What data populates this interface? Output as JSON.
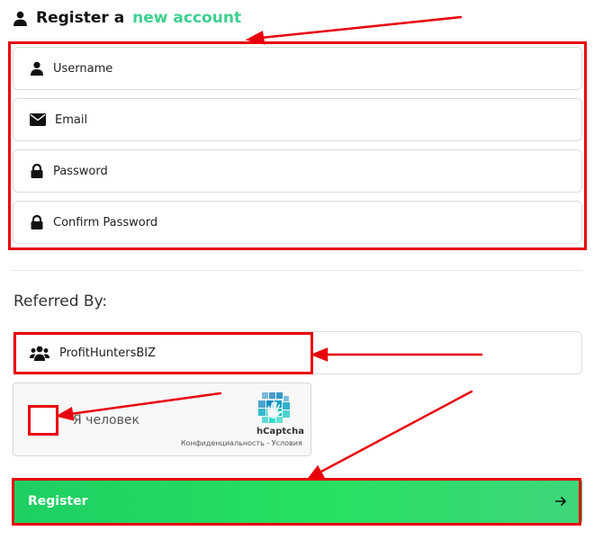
{
  "header": {
    "title_prefix": "Register a",
    "title_accent": "new account",
    "accent_color": "#3ecf8e",
    "icon": "user-icon"
  },
  "form": {
    "username_placeholder": "Username",
    "email_placeholder": "Email",
    "password_placeholder": "Password",
    "confirm_password_placeholder": "Confirm Password"
  },
  "referral": {
    "label": "Referred By:",
    "value": "ProfitHuntersBIZ",
    "icon": "users-icon"
  },
  "captcha": {
    "checkbox_label": "Я человек",
    "brand": "hCaptcha",
    "links": "Конфиденциальность - Условия"
  },
  "submit": {
    "label": "Register",
    "icon": "arrow-right-icon",
    "color": "#27e062"
  },
  "annotation_color": "#e8000e"
}
